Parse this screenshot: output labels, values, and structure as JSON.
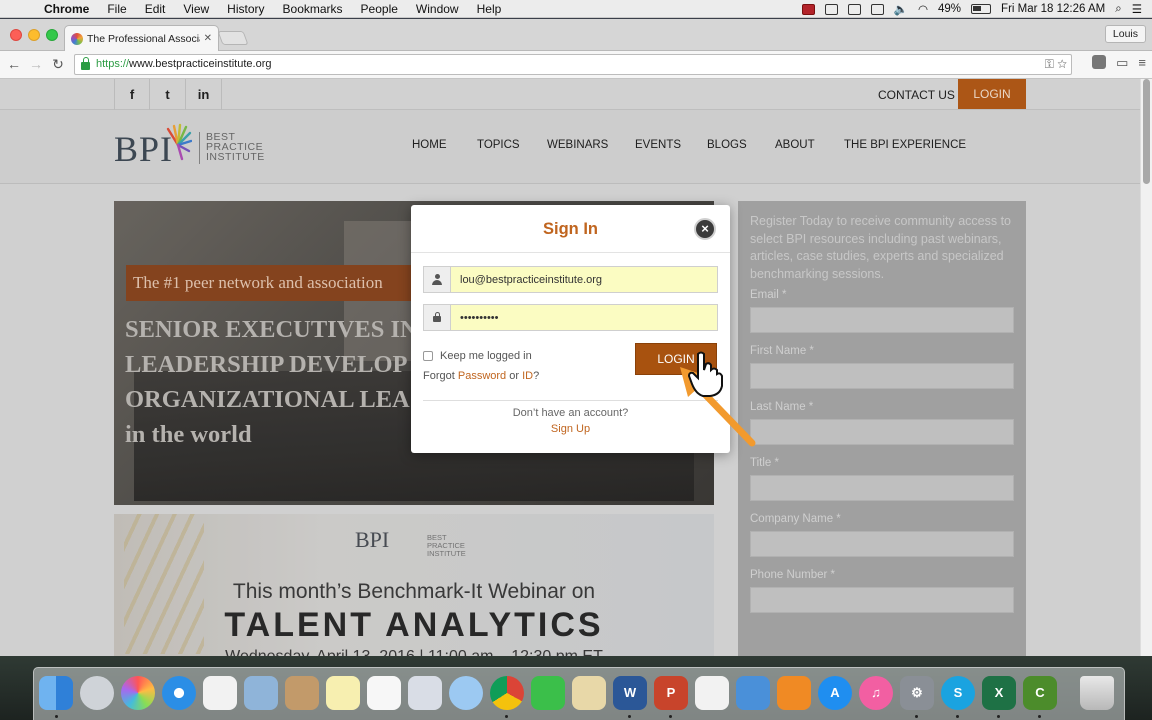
{
  "menubar": {
    "app": "Chrome",
    "items": [
      "File",
      "Edit",
      "View",
      "History",
      "Bookmarks",
      "People",
      "Window",
      "Help"
    ],
    "battery": "49%",
    "datetime": "Fri Mar 18  12:26 AM"
  },
  "browser": {
    "tab_title": "The Professional Associatio",
    "profile": "Louis",
    "url_scheme": "https://",
    "url_host": "www.bestpracticeinstitute.org"
  },
  "site": {
    "social": [
      "f",
      "t",
      "in"
    ],
    "contact": "CONTACT US",
    "login": "LOGIN",
    "logo_text": "BPI",
    "logo_tag": [
      "BEST",
      "PRACTICE",
      "INSTITUTE"
    ],
    "nav": [
      "HOME",
      "TOPICS",
      "WEBINARS",
      "EVENTS",
      "BLOGS",
      "ABOUT",
      "THE BPI EXPERIENCE"
    ],
    "hero": {
      "ribbon": "The #1 peer network and association",
      "lines": [
        "SENIOR EXECUTIVES IN",
        "LEADERSHIP DEVELOP",
        "ORGANIZATIONAL LEA",
        "in the world"
      ]
    },
    "webinar": {
      "subtitle": "This month’s Benchmark-It Webinar on",
      "title": "TALENT ANALYTICS",
      "date": "Wednesday, April 13, 2016 | 11:00 am – 12:30 pm ET"
    },
    "register": {
      "intro": "Register Today to receive community access to select BPI resources including past webinars, articles, case studies, experts and specialized benchmarking sessions.",
      "fields": [
        "Email *",
        "First Name *",
        "Last Name *",
        "Title *",
        "Company Name *",
        "Phone Number *"
      ]
    }
  },
  "modal": {
    "title": "Sign In",
    "email_value": "lou@bestpracticeinstitute.org",
    "password_value": "••••••••••",
    "keep_logged_in": "Keep me logged in",
    "forgot_prefix": "Forgot ",
    "forgot_password": "Password",
    "forgot_or": " or ",
    "forgot_id": "ID",
    "forgot_suffix": "?",
    "login_button": "LOGIN",
    "no_account": "Don’t have an account?",
    "signup": "Sign Up",
    "accent": "#c0651f"
  },
  "dock": {
    "apps": [
      "finder",
      "launchpad",
      "photos",
      "safari",
      "grid-app",
      "preview",
      "contacts",
      "notes",
      "reminders",
      "mail-preview",
      "messages",
      "chrome",
      "facetime",
      "photo-browser",
      "word",
      "powerpoint",
      "numbers",
      "keynote",
      "ibooks",
      "app-store",
      "itunes",
      "system-preferences",
      "skype",
      "excel",
      "camtasia",
      "trash"
    ]
  }
}
